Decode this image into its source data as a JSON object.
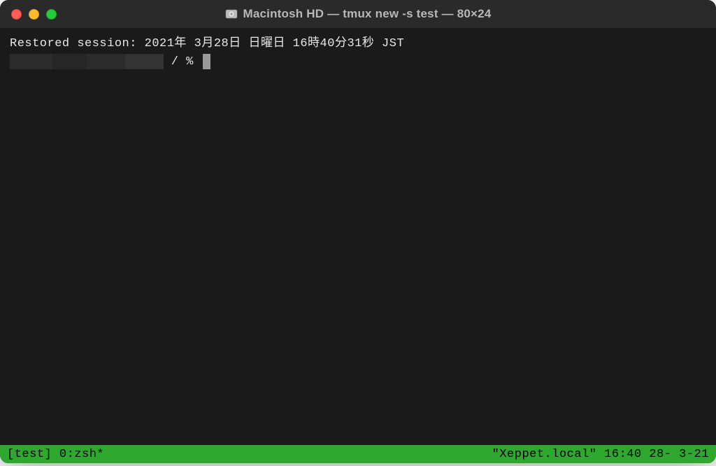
{
  "titlebar": {
    "title": "Macintosh HD — tmux new -s test — 80×24"
  },
  "terminal": {
    "restored_line": "Restored session: 2021年 3月28日 日曜日 16時40分31秒 JST",
    "prompt_suffix": " / % "
  },
  "statusbar": {
    "left": "[test] 0:zsh*",
    "right": "\"Xeppet.local\" 16:40 28- 3-21"
  }
}
